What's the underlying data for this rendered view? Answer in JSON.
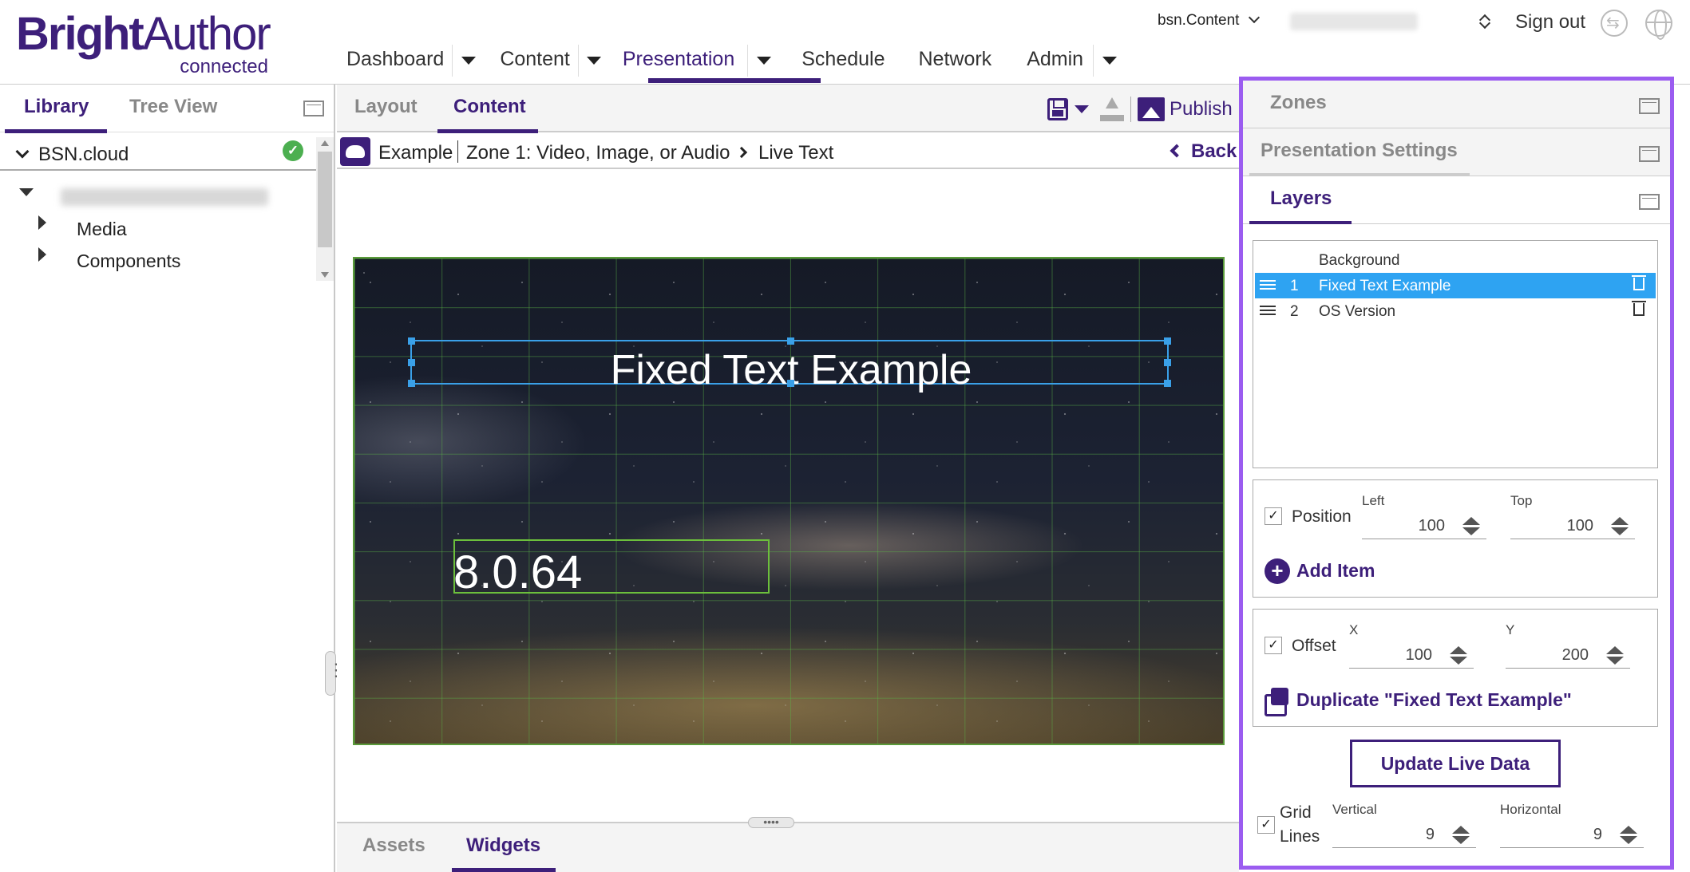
{
  "app": {
    "logo_brand_bold": "Bright",
    "logo_brand_light": "Author",
    "logo_sub": "connected"
  },
  "header": {
    "nav": [
      {
        "label": "Dashboard"
      },
      {
        "label": "Content"
      },
      {
        "label": "Presentation"
      },
      {
        "label": "Schedule"
      },
      {
        "label": "Network"
      },
      {
        "label": "Admin"
      }
    ],
    "active_nav": "Presentation",
    "network_select": "bsn.Content",
    "sign_out": "Sign out"
  },
  "left_panel": {
    "tabs": [
      {
        "label": "Library"
      },
      {
        "label": "Tree View"
      }
    ],
    "active_tab": "Library",
    "tree_root": "BSN.cloud",
    "tree_items": [
      {
        "label": "Media"
      },
      {
        "label": "Components"
      }
    ]
  },
  "center": {
    "tabs": [
      {
        "label": "Layout"
      },
      {
        "label": "Content"
      }
    ],
    "active_tab": "Content",
    "publish_label": "Publish",
    "breadcrumb": {
      "presentation": "Example",
      "zone": "Zone 1: Video, Image, or Audio",
      "item": "Live Text"
    },
    "back_label": "Back",
    "canvas": {
      "fixed_text": "Fixed Text Example",
      "os_version_text": "8.0.64"
    },
    "bottom_tabs": [
      {
        "label": "Assets"
      },
      {
        "label": "Widgets"
      }
    ],
    "active_bottom_tab": "Widgets"
  },
  "right_panel": {
    "sections": [
      {
        "label": "Zones"
      },
      {
        "label": "Presentation Settings"
      },
      {
        "label": "Layers"
      }
    ],
    "active_section": "Layers",
    "layers": {
      "background_label": "Background",
      "items": [
        {
          "num": "1",
          "name": "Fixed Text Example",
          "selected": true
        },
        {
          "num": "2",
          "name": "OS Version",
          "selected": false
        }
      ]
    },
    "position": {
      "label": "Position",
      "checked": true,
      "left_label": "Left",
      "left_value": "100",
      "top_label": "Top",
      "top_value": "100",
      "add_item": "Add Item"
    },
    "offset": {
      "label": "Offset",
      "checked": true,
      "x_label": "X",
      "x_value": "100",
      "y_label": "Y",
      "y_value": "200",
      "duplicate": "Duplicate \"Fixed Text Example\""
    },
    "update_button": "Update Live Data",
    "grid": {
      "label_line1": "Grid",
      "label_line2": "Lines",
      "checked": true,
      "vertical_label": "Vertical",
      "vertical_value": "9",
      "horizontal_label": "Horizontal",
      "horizontal_value": "9"
    }
  },
  "colors": {
    "brand": "#3d1f7a",
    "selected_row": "#2ea3f2",
    "panel_highlight": "#9b5cf0",
    "grid": "#5a9a3a",
    "text_box_selected": "#3aa0e8"
  },
  "icons": {
    "check": "✓",
    "plus": "+",
    "drag_dots": "••••"
  }
}
